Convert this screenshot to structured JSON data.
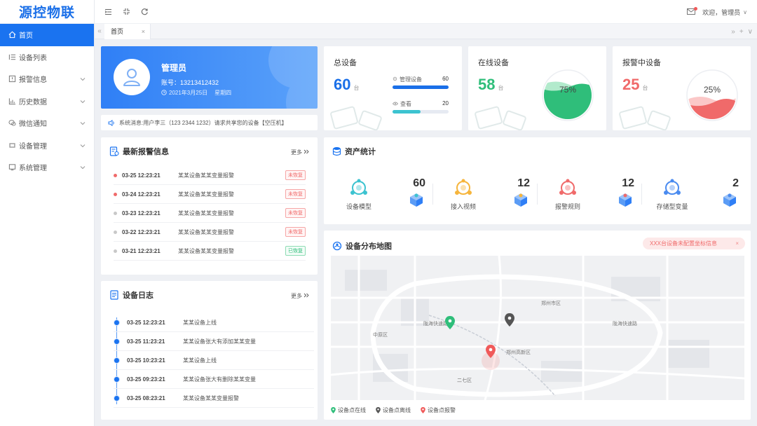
{
  "app": {
    "logo": "源控物联"
  },
  "sidebar": {
    "items": [
      {
        "label": "首页",
        "active": true,
        "icon": "home-icon"
      },
      {
        "label": "设备列表",
        "icon": "list-icon"
      },
      {
        "label": "报警信息",
        "icon": "alarm-icon",
        "expandable": true
      },
      {
        "label": "历史数据",
        "icon": "history-chart-icon",
        "expandable": true
      },
      {
        "label": "微信通知",
        "icon": "wechat-icon",
        "expandable": true
      },
      {
        "label": "设备管理",
        "icon": "device-icon",
        "expandable": true
      },
      {
        "label": "系统管理",
        "icon": "system-icon",
        "expandable": true
      }
    ]
  },
  "topbar": {
    "icons": [
      "menu-fold-icon",
      "compress-icon",
      "refresh-icon"
    ],
    "welcome": "欢迎，管理员",
    "caret": "∨"
  },
  "tabs": {
    "items": [
      {
        "label": "首页",
        "close": "×"
      }
    ],
    "left_arrow": "«",
    "right_controls": [
      "»",
      "+",
      "∨"
    ]
  },
  "profile": {
    "name": "管理员",
    "account": "账号：13213412432",
    "date": "2021年3月25日",
    "weekday": "星期四"
  },
  "notice": {
    "text": "系统消息:用户李三（123 2344 1232）请求共享您的设备【空压机】"
  },
  "stats": {
    "total": {
      "title": "总设备",
      "value": "60",
      "unit": "台",
      "rows": [
        {
          "label": "管理设备",
          "value": "60",
          "fraction": 1.0,
          "color": "#1a6fe8",
          "icon": "gear-icon"
        },
        {
          "label": "查看",
          "value": "20",
          "fraction": 0.5,
          "color": "#3cc3d0",
          "icon": "eye-icon"
        }
      ]
    },
    "online": {
      "title": "在线设备",
      "value": "58",
      "unit": "台",
      "percent": "75%",
      "fraction": 0.75,
      "color": "#2fbe7a",
      "wave": "#7fdcaa"
    },
    "alarm": {
      "title": "报警中设备",
      "value": "25",
      "unit": "台",
      "percent": "25%",
      "fraction": 0.25,
      "color": "#f06a6a",
      "wave": "#f8a3a3"
    }
  },
  "alarms": {
    "title": "最新报警信息",
    "more": "更多",
    "rows": [
      {
        "time": "03-25 12:23:21",
        "desc": "某某设备某某变量报警",
        "status": "未恢复",
        "state": "red",
        "dot": "#f06a6a"
      },
      {
        "time": "03-24 12:23:21",
        "desc": "某某设备某某变量报警",
        "status": "未恢复",
        "state": "red",
        "dot": "#f06a6a"
      },
      {
        "time": "03-23 12:23:21",
        "desc": "某某设备某某变量报警",
        "status": "未恢复",
        "state": "red",
        "dot": "#c8c8c8"
      },
      {
        "time": "03-22 12:23:21",
        "desc": "某某设备某某变量报警",
        "status": "未恢复",
        "state": "red",
        "dot": "#c8c8c8"
      },
      {
        "time": "03-21 12:23:21",
        "desc": "某某设备某某变量报警",
        "status": "已恢复",
        "state": "green",
        "dot": "#c8c8c8"
      }
    ]
  },
  "logs": {
    "title": "设备日志",
    "more": "更多",
    "rows": [
      {
        "time": "03-25 12:23:21",
        "desc": "某某设备上线"
      },
      {
        "time": "03-25 11:23:21",
        "desc": "某某设备张大有添加某某变量"
      },
      {
        "time": "03-25 10:23:21",
        "desc": "某某设备上线"
      },
      {
        "time": "03-25 09:23:21",
        "desc": "某某设备张大有删除某某变量"
      },
      {
        "time": "03-25 08:23:21",
        "desc": "某某设备某某变量报警"
      }
    ]
  },
  "assets": {
    "title": "资产统计",
    "items": [
      {
        "label": "设备模型",
        "value": "60",
        "icon": "device-model-icon",
        "color": "#3cc3d0"
      },
      {
        "label": "接入视频",
        "value": "12",
        "icon": "video-access-icon",
        "color": "#f6b53c"
      },
      {
        "label": "报警规则",
        "value": "12",
        "icon": "alarm-rule-icon",
        "color": "#f06a6a"
      },
      {
        "label": "存储型变量",
        "value": "2",
        "icon": "storage-variable-icon",
        "color": "#4a8bf0"
      }
    ]
  },
  "map": {
    "title": "设备分布地图",
    "alert": "XXX台设备未配置坐标信息",
    "alert_close": "×",
    "labels": [
      "陇海快速路",
      "陇海快速路",
      "郑州高新区",
      "郑州市区",
      "中原区",
      "二七区"
    ],
    "legend": [
      {
        "label": "设备点在线",
        "color": "#2fbe7a"
      },
      {
        "label": "设备点离线",
        "color": "#555555"
      },
      {
        "label": "设备点报警",
        "color": "#f05a5a"
      }
    ]
  }
}
